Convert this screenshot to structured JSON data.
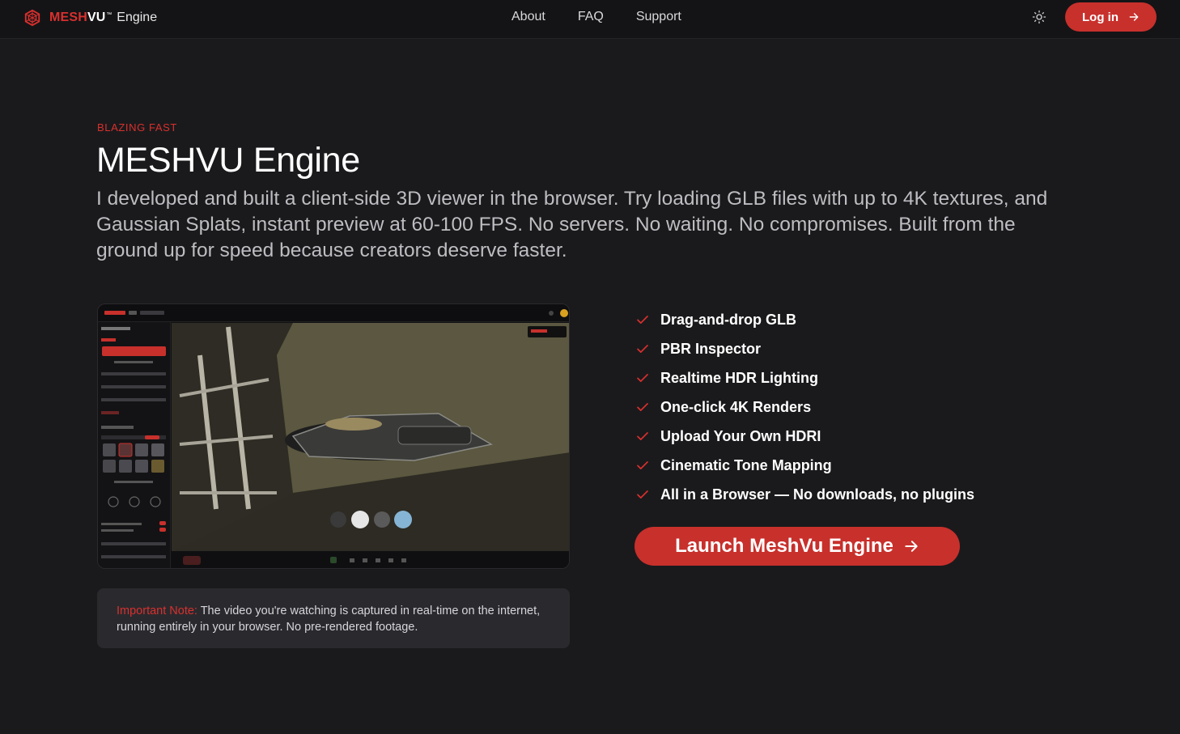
{
  "brand": {
    "name_part1": "MESH",
    "name_part2": "VU",
    "trademark": "™",
    "product": "Engine",
    "accent_color": "#d9302e"
  },
  "nav": {
    "items": [
      {
        "label": "About"
      },
      {
        "label": "FAQ"
      },
      {
        "label": "Support"
      }
    ],
    "theme_icon": "sun-icon",
    "login_label": "Log in"
  },
  "hero": {
    "kicker": "BLAZING FAST",
    "title": "MESHVU Engine",
    "lead": "I developed and built a client-side 3D viewer in the browser. Try loading GLB files with up to 4K textures, and Gaussian Splats, instant preview at 60-100 FPS. No servers. No waiting. No compromises. Built from the ground up for speed because creators deserve faster."
  },
  "note": {
    "label": "Important Note:",
    "text": " The video you're watching is captured in real-time on the internet, running entirely in your browser. No pre-rendered footage."
  },
  "features": [
    {
      "label": "Drag-and-drop GLB"
    },
    {
      "label": "PBR Inspector"
    },
    {
      "label": "Realtime HDR Lighting"
    },
    {
      "label": "One-click 4K Renders"
    },
    {
      "label": "Upload Your Own HDRI"
    },
    {
      "label": "Cinematic Tone Mapping"
    },
    {
      "label": "All in a Browser — No downloads, no plugins"
    }
  ],
  "cta": {
    "label": "Launch MeshVu Engine"
  }
}
